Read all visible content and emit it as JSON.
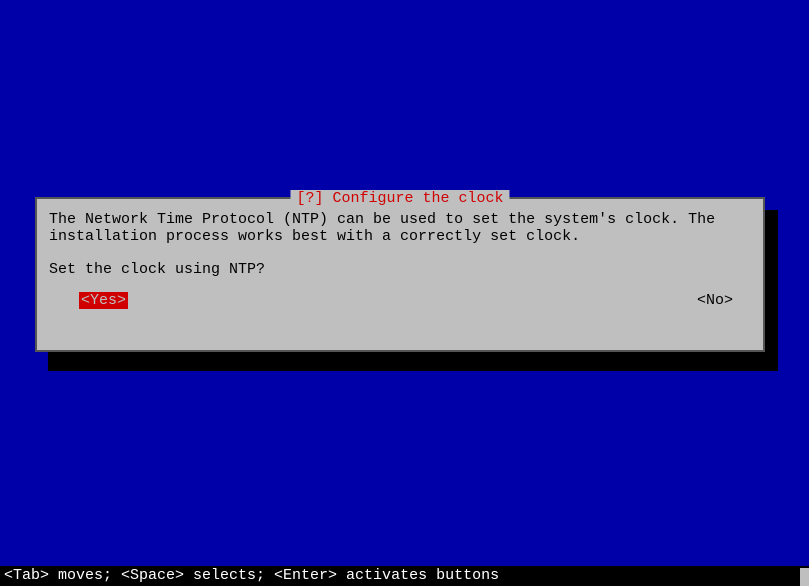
{
  "dialog": {
    "title": "[?] Configure the clock",
    "body": "The Network Time Protocol (NTP) can be used to set the system's clock. The installation process works best with a correctly set clock.",
    "question": "Set the clock using NTP?",
    "yes": "<Yes>",
    "no": "<No>"
  },
  "footer": "<Tab> moves; <Space> selects; <Enter> activates buttons"
}
